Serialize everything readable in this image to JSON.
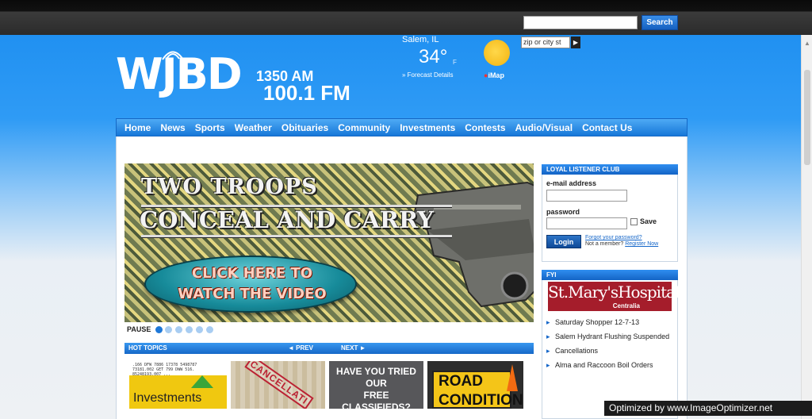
{
  "header": {
    "search_placeholder": "",
    "search_button": "Search"
  },
  "logo": {
    "letters": "WJBD",
    "am": "1350 AM",
    "fm": "100.1 FM"
  },
  "weather": {
    "city": "Salem, IL",
    "temperature": "34°",
    "unit": "F",
    "forecast_link": "» Forecast Details",
    "imap_label": "iMap",
    "zip_placeholder": "zip or city st",
    "go_label": "▶",
    "icon": "sun-icon",
    "sun_color": "#f5c21b"
  },
  "nav": {
    "items": [
      "Home",
      "News",
      "Sports",
      "Weather",
      "Obituaries",
      "Community",
      "Investments",
      "Contests",
      "Audio/Visual",
      "Contact Us"
    ]
  },
  "banner": {
    "title_line1": "TWO TROOPS",
    "title_line2": "CONCEAL AND CARRY",
    "cta_line1": "CLICK HERE TO",
    "cta_line2": "WATCH THE VIDEO",
    "pause_label": "PAUSE",
    "slides": 6,
    "active_slide": 1
  },
  "hot_topics": {
    "title": "HOT TOPICS",
    "prev": "◄ PREV",
    "next": "NEXT ►",
    "thumb1_numbers": ".166 DFW 7886 17378 5498787\n73181.002 GET 799 DWW 516.\n85248193.007 ...",
    "thumb1_label": "Investments",
    "thumb2_stamp": "CANCELLATI",
    "thumb3_line1": "HAVE YOU TRIED OUR",
    "thumb3_line2": "FREE",
    "thumb3_line3": "CLASSIFIEDS?",
    "thumb4_line1": "ROAD",
    "thumb4_line2": "CONDITIONS"
  },
  "listener_club": {
    "title": "LOYAL LISTENER CLUB",
    "email_label": "e-mail address",
    "password_label": "password",
    "save_label": "Save",
    "login_button": "Login",
    "forgot_link": "Forgot your password?",
    "not_member": "Not a member?",
    "register_link": "Register Now"
  },
  "fyi": {
    "title": "FYI",
    "sponsor_name": "St.Mary'sHospital",
    "sponsor_location": "Centralia",
    "items": [
      "Saturday Shopper 12-7-13",
      "Salem Hydrant Flushing Suspended",
      "Cancellations",
      "Alma and Raccoon Boil Orders"
    ]
  },
  "watermark": "Optimized by www.ImageOptimizer.net",
  "colors": {
    "brand_blue": "#1a8cf0",
    "nav_blue": "#1677d8",
    "hospital_red": "#a51d2b"
  }
}
